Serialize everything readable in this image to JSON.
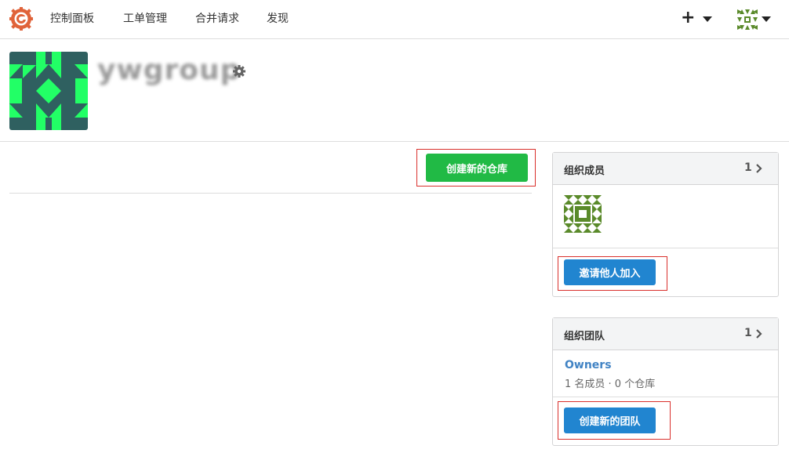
{
  "nav": {
    "items": [
      "控制面板",
      "工单管理",
      "合并请求",
      "发现"
    ],
    "plus_label": "+"
  },
  "icons": {
    "logo": "gitea-logo-icon",
    "user_avatar": "user-avatar-icon",
    "settings": "gear-icon",
    "chevron": "chevron-right-icon"
  },
  "org": {
    "name": "ywgroup"
  },
  "repos": {
    "create_button": "创建新的仓库"
  },
  "members_panel": {
    "title": "组织成员",
    "count": "1",
    "invite_button": "邀请他人加入"
  },
  "teams_panel": {
    "title": "组织团队",
    "count": "1",
    "teams": [
      {
        "name": "Owners",
        "meta": "1 名成员 · 0 个仓库"
      }
    ],
    "create_button": "创建新的团队"
  },
  "colors": {
    "green_button": "#21ba45",
    "blue_button": "#2185d0",
    "link": "#4183c4",
    "annotation_box": "#d9302c",
    "org_avatar_bg": "#2f6060",
    "org_avatar_fg": "#22ff66",
    "identicon": "#5a8a2a",
    "logo": "#e0633a"
  }
}
